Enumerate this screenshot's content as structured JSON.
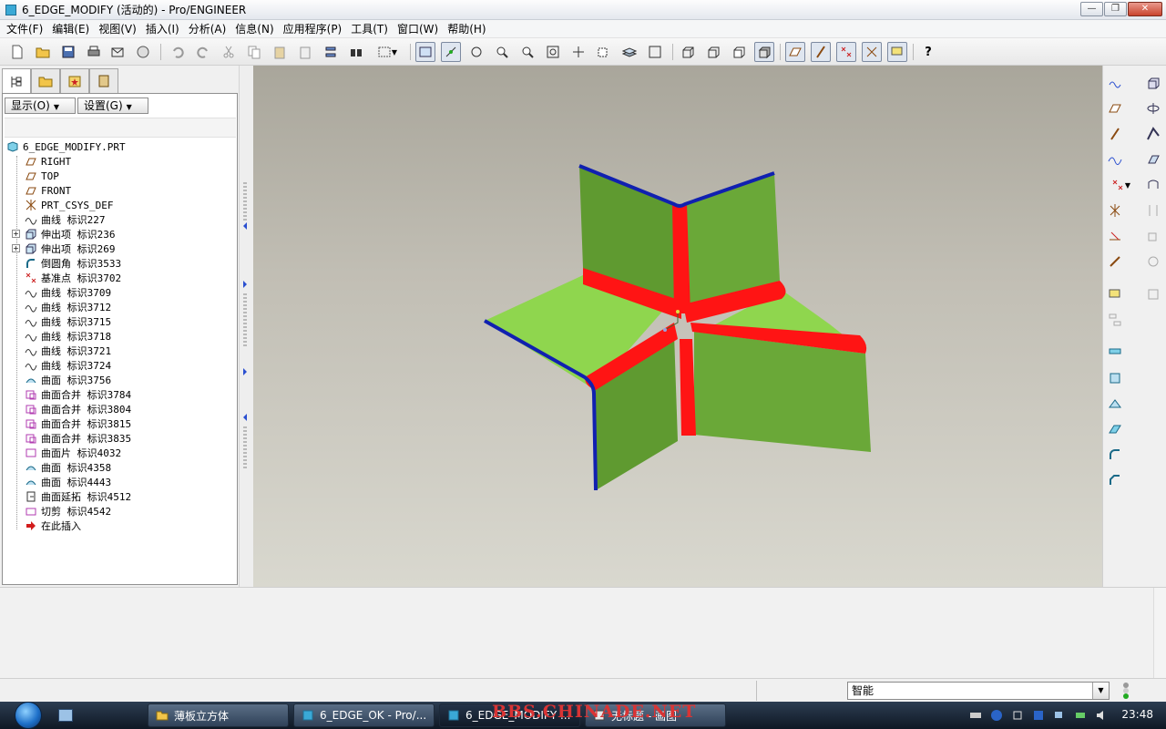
{
  "window": {
    "title": "6_EDGE_MODIFY (活动的) - Pro/ENGINEER",
    "minimize": "—",
    "restore": "❐",
    "close": "✕"
  },
  "menu": [
    "文件(F)",
    "编辑(E)",
    "视图(V)",
    "插入(I)",
    "分析(A)",
    "信息(N)",
    "应用程序(P)",
    "工具(T)",
    "窗口(W)",
    "帮助(H)"
  ],
  "toolbar": {
    "help_glyph": "?"
  },
  "model_tree": {
    "show_button": "显示(O)",
    "settings_button": "设置(G)",
    "root": "6_EDGE_MODIFY.PRT",
    "items": [
      {
        "label": "RIGHT",
        "icon": "datum-plane-icon"
      },
      {
        "label": "TOP",
        "icon": "datum-plane-icon"
      },
      {
        "label": "FRONT",
        "icon": "datum-plane-icon"
      },
      {
        "label": "PRT_CSYS_DEF",
        "icon": "csys-icon"
      },
      {
        "label": "曲线 标识227",
        "icon": "curve-icon"
      },
      {
        "label": "伸出项 标识236",
        "icon": "extrude-icon",
        "expandable": true
      },
      {
        "label": "伸出项 标识269",
        "icon": "extrude-icon",
        "expandable": true
      },
      {
        "label": "倒圆角 标识3533",
        "icon": "round-icon"
      },
      {
        "label": "基准点 标识3702",
        "icon": "datum-point-icon"
      },
      {
        "label": "曲线 标识3709",
        "icon": "curve-icon"
      },
      {
        "label": "曲线 标识3712",
        "icon": "curve-icon"
      },
      {
        "label": "曲线 标识3715",
        "icon": "curve-icon"
      },
      {
        "label": "曲线 标识3718",
        "icon": "curve-icon"
      },
      {
        "label": "曲线 标识3721",
        "icon": "curve-icon"
      },
      {
        "label": "曲线 标识3724",
        "icon": "curve-icon"
      },
      {
        "label": "曲面 标识3756",
        "icon": "surface-icon"
      },
      {
        "label": "曲面合并 标识3784",
        "icon": "merge-icon"
      },
      {
        "label": "曲面合并 标识3804",
        "icon": "merge-icon"
      },
      {
        "label": "曲面合并 标识3815",
        "icon": "merge-icon"
      },
      {
        "label": "曲面合并 标识3835",
        "icon": "merge-icon"
      },
      {
        "label": "曲面片 标识4032",
        "icon": "patch-icon"
      },
      {
        "label": "曲面 标识4358",
        "icon": "surface-icon"
      },
      {
        "label": "曲面 标识4443",
        "icon": "surface-icon"
      },
      {
        "label": "曲面延拓 标识4512",
        "icon": "extend-icon"
      },
      {
        "label": "切剪 标识4542",
        "icon": "cut-icon"
      },
      {
        "label": "在此插入",
        "icon": "insert-here-arrow-icon"
      }
    ]
  },
  "status": {
    "filter_value": "智能"
  },
  "taskbar": {
    "tasks": [
      {
        "label": "薄板立方体",
        "icon": "folder-icon"
      },
      {
        "label": "6_EDGE_OK - Pro/...",
        "icon": "proe-icon"
      },
      {
        "label": "6_EDGE_MODIFY ...",
        "icon": "proe-icon",
        "active": true
      },
      {
        "label": "无标题 - 画图",
        "icon": "paint-icon"
      }
    ],
    "watermark": "BBS.CHINADE.NET",
    "clock": "23:48"
  },
  "colors": {
    "sheet_light": "#8fd64e",
    "sheet_dark": "#5f9a30",
    "round_edges": "#ff1414",
    "outer_edges": "#1020b0"
  }
}
